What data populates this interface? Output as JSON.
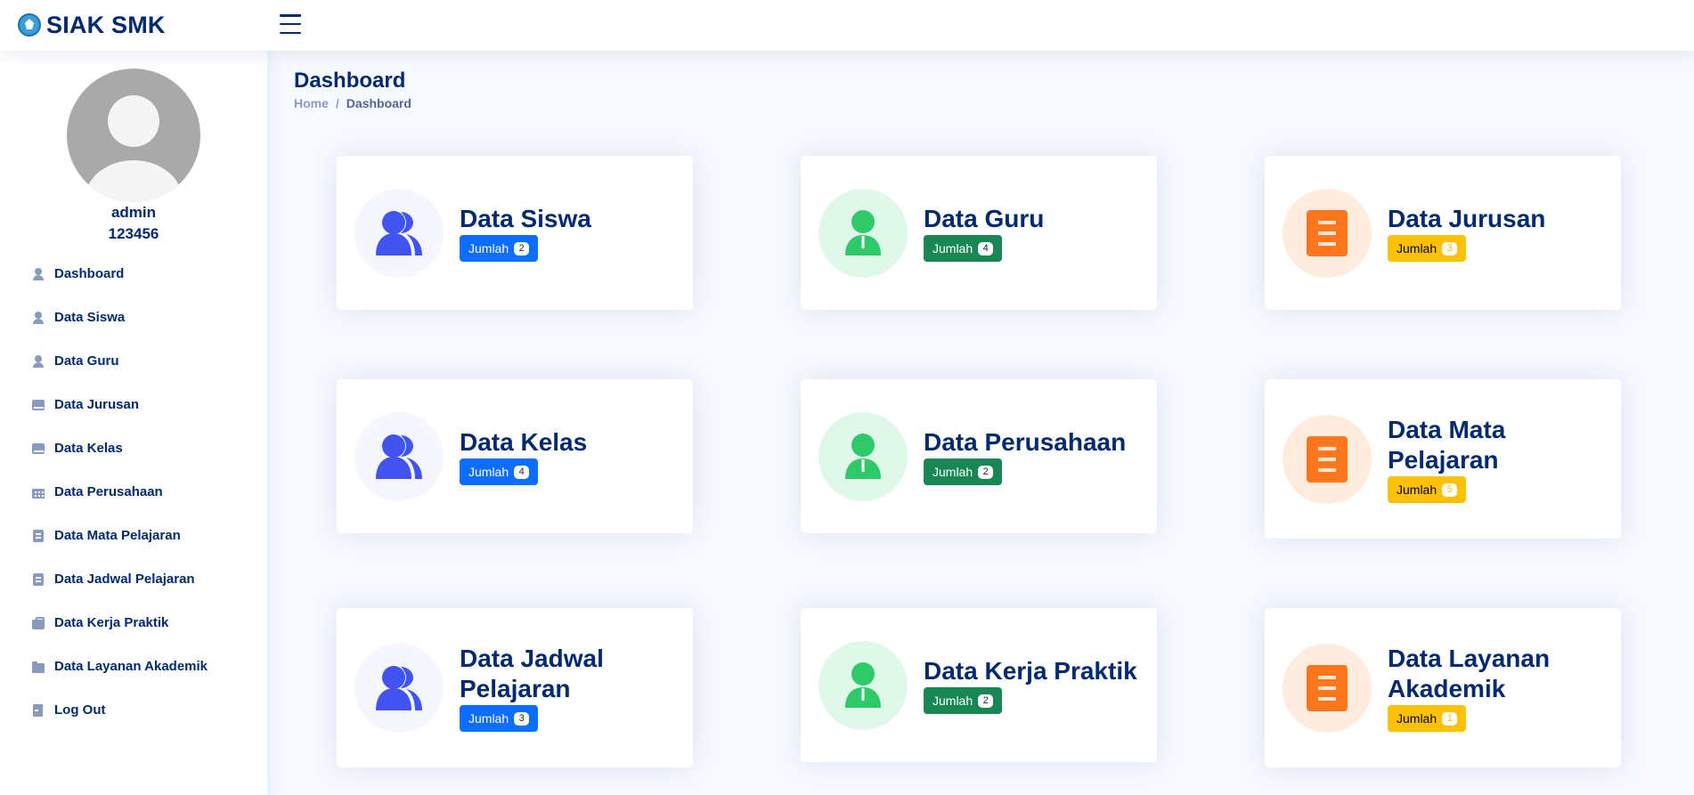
{
  "header": {
    "brand": "SIAK SMK"
  },
  "user": {
    "name": "admin",
    "id": "123456"
  },
  "sidebar": {
    "items": [
      {
        "label": "Dashboard",
        "icon": "person-icon"
      },
      {
        "label": "Data Siswa",
        "icon": "person-icon"
      },
      {
        "label": "Data Guru",
        "icon": "person-icon"
      },
      {
        "label": "Data Jurusan",
        "icon": "book-icon"
      },
      {
        "label": "Data Kelas",
        "icon": "book-icon"
      },
      {
        "label": "Data Perusahaan",
        "icon": "building-icon"
      },
      {
        "label": "Data Mata Pelajaran",
        "icon": "journal-icon"
      },
      {
        "label": "Data Jadwal Pelajaran",
        "icon": "journal-icon"
      },
      {
        "label": "Data Kerja Praktik",
        "icon": "briefcase-icon"
      },
      {
        "label": "Data Layanan Akademik",
        "icon": "folder-icon"
      },
      {
        "label": "Log Out",
        "icon": "logout-icon"
      }
    ]
  },
  "page": {
    "title": "Dashboard",
    "breadcrumb": {
      "home": "Home",
      "separator": "/",
      "current": "Dashboard"
    }
  },
  "cards": [
    {
      "title": "Data Siswa",
      "button": "Jumlah",
      "count": "2",
      "color": "#0d6efd",
      "icon": "people-icon"
    },
    {
      "title": "Data Guru",
      "button": "Jumlah",
      "count": "4",
      "color": "#198754",
      "icon": "person-icon"
    },
    {
      "title": "Data Jurusan",
      "button": "Jumlah",
      "count": "3",
      "color": "#ffc107",
      "icon": "document-icon"
    },
    {
      "title": "Data Kelas",
      "button": "Jumlah",
      "count": "4",
      "color": "#0d6efd",
      "icon": "people-icon"
    },
    {
      "title": "Data Perusahaan",
      "button": "Jumlah",
      "count": "2",
      "color": "#198754",
      "icon": "person-icon"
    },
    {
      "title": "Data Mata Pelajaran",
      "button": "Jumlah",
      "count": "5",
      "color": "#ffc107",
      "icon": "document-icon"
    },
    {
      "title": "Data Jadwal Pelajaran",
      "button": "Jumlah",
      "count": "3",
      "color": "#0d6efd",
      "icon": "people-icon"
    },
    {
      "title": "Data Kerja Praktik",
      "button": "Jumlah",
      "count": "2",
      "color": "#198754",
      "icon": "person-icon"
    },
    {
      "title": "Data Layanan Akademik",
      "button": "Jumlah",
      "count": "1",
      "color": "#ffc107",
      "icon": "document-icon"
    }
  ]
}
